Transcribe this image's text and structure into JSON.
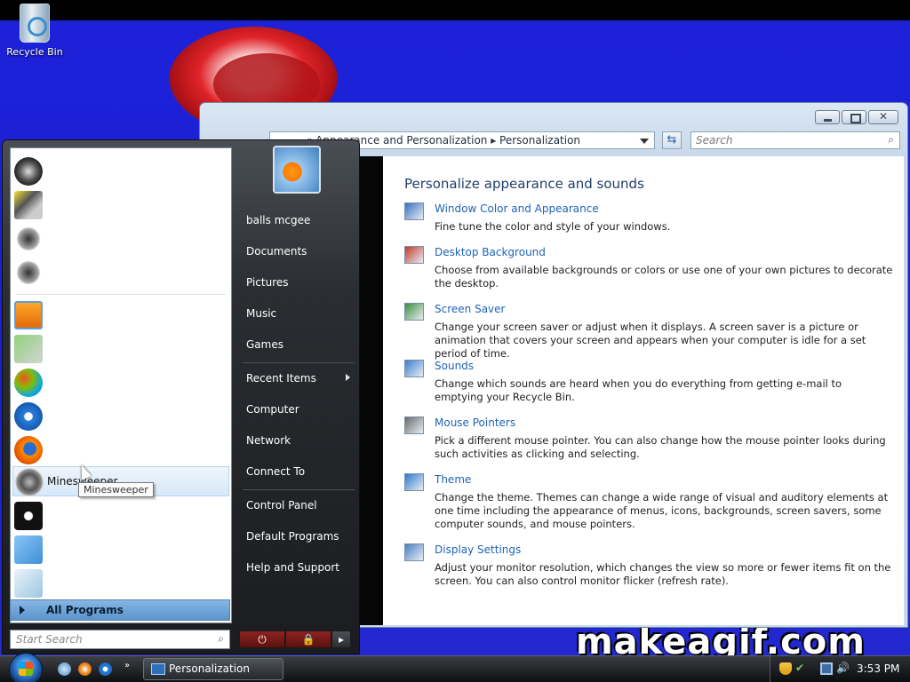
{
  "desktop": {
    "recycle_bin_label": "Recycle Bin",
    "watermark": "makeagif.com"
  },
  "window": {
    "title": "Personalization",
    "breadcrumb": [
      "Appearance and Personalization",
      "Personalization"
    ],
    "breadcrumb_text": "«  Appearance and Personalization  ▸  Personalization",
    "search_placeholder": "Search",
    "heading": "Personalize appearance and sounds",
    "tasks": [
      {
        "icon": "color-appearance-icon",
        "title": "Window Color and Appearance",
        "desc": "Fine tune the color and style of your windows."
      },
      {
        "icon": "desktop-background-icon",
        "title": "Desktop Background",
        "desc": "Choose from available backgrounds or colors or use one of your own pictures to decorate the desktop."
      },
      {
        "icon": "screen-saver-icon",
        "title": "Screen Saver",
        "desc": "Change your screen saver or adjust when it displays. A screen saver is a picture or animation that covers your screen and appears when your computer is idle for a set period of time."
      },
      {
        "icon": "sounds-icon",
        "title": "Sounds",
        "desc": "Change which sounds are heard when you do everything from getting e-mail to emptying your Recycle Bin."
      },
      {
        "icon": "mouse-pointers-icon",
        "title": "Mouse Pointers",
        "desc": "Pick a different mouse pointer. You can also change how the mouse pointer looks during such activities as clicking and selecting."
      },
      {
        "icon": "theme-icon",
        "title": "Theme",
        "desc": "Change the theme. Themes can change a wide range of visual and auditory elements at one time including the appearance of menus, icons, backgrounds, screen savers, some computer sounds, and mouse pointers."
      },
      {
        "icon": "display-settings-icon",
        "title": "Display Settings",
        "desc": "Adjust your monitor resolution, which changes the view so more or fewer items fit on the screen. You can also control monitor flicker (refresh rate)."
      }
    ]
  },
  "start_menu": {
    "hovered_program": "Minesweeper",
    "tooltip": "Minesweeper",
    "all_programs": "All Programs",
    "search_placeholder": "Start Search",
    "user_name": "balls mcgee",
    "right_items": [
      "Documents",
      "Pictures",
      "Music",
      "Games",
      "Recent Items",
      "Computer",
      "Network",
      "Connect To",
      "Control Panel",
      "Default Programs",
      "Help and Support"
    ]
  },
  "taskbar": {
    "task_button": "Personalization",
    "clock": "3:53 PM"
  }
}
